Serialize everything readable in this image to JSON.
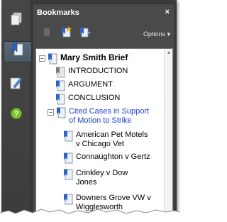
{
  "panel": {
    "title": "Bookmarks",
    "close_glyph": "×",
    "options_label": "Options ▾"
  },
  "rail": {
    "buttons": [
      "pages-icon",
      "bookmarks-icon",
      "signatures-icon",
      "help-icon"
    ]
  },
  "toolbar": {
    "buttons": [
      "delete-bookmark-icon",
      "new-bookmark-icon",
      "expand-bookmark-icon"
    ]
  },
  "tree": {
    "root": {
      "label": "Mary Smith Brief",
      "expander": "⊟"
    },
    "items": [
      {
        "label": "INTRODUCTION"
      },
      {
        "label": "ARGUMENT"
      },
      {
        "label": "CONCLUSION"
      }
    ],
    "group": {
      "label_line1": "Cited Cases in Support",
      "label_line2": "of Motion to Strike",
      "expander": "⊟",
      "children": [
        {
          "line1": "American Pet Motels",
          "line2": "v Chicago Vet"
        },
        {
          "line1": "Connaughton v Gertz",
          "line2": ""
        },
        {
          "line1": "Crinkley v Dow",
          "line2": "Jones"
        },
        {
          "line1": "Downers Grove VW v",
          "line2": "Wigglesworth"
        }
      ]
    }
  },
  "colors": {
    "panel_bg": "#4a4a4a",
    "link_blue": "#1a3fcf",
    "help_green": "#7cc22c"
  }
}
